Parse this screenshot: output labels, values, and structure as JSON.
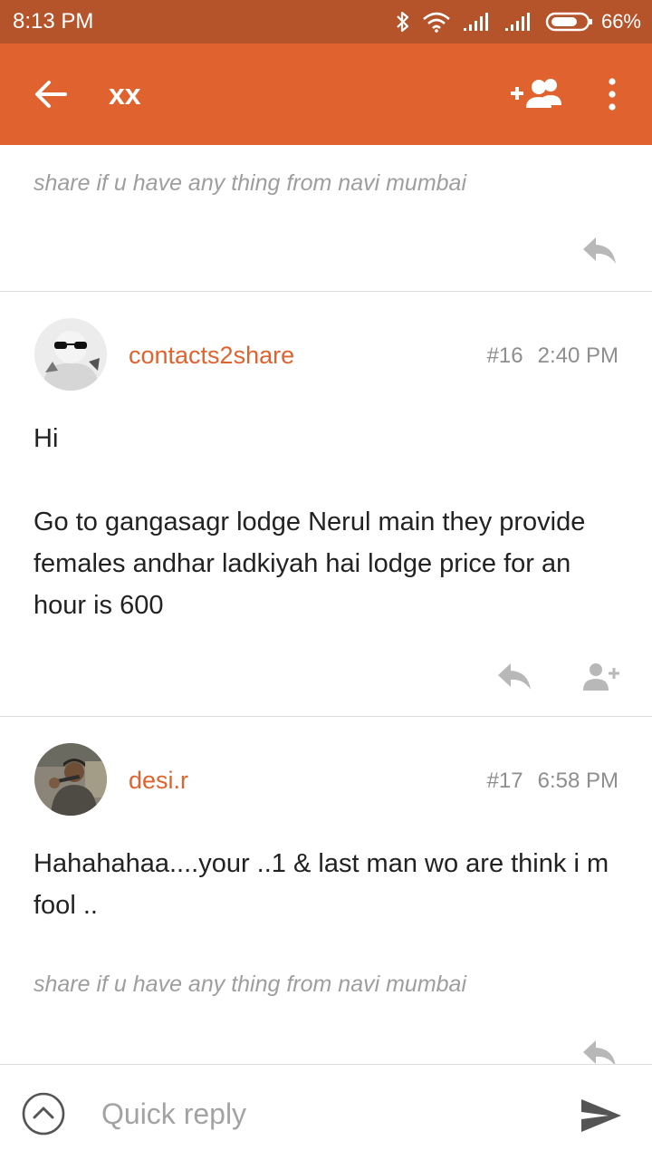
{
  "status_bar": {
    "time": "8:13 PM",
    "battery": "66%",
    "icons": [
      "bluetooth-icon",
      "wifi-icon",
      "signal-icon",
      "signal-icon",
      "battery-icon"
    ]
  },
  "app_bar": {
    "title": "xx",
    "icons": [
      "back-arrow-icon",
      "add-people-icon",
      "more-vert-icon"
    ]
  },
  "thread": {
    "quote_top": "share if u have any thing from navi mumbai",
    "posts": [
      {
        "author": "contacts2share",
        "number": "#16",
        "time": "2:40 PM",
        "body": [
          "Hi",
          "Go to gangasagr lodge Nerul main they provide females andhar ladkiyah hai lodge price for an hour is 600"
        ]
      },
      {
        "author": "desi.r",
        "number": "#17",
        "time": "6:58 PM",
        "body": [
          "Hahahahaa....your ..1 & last man wo are think i m fool .."
        ],
        "quote": "share if u have any thing from navi mumbai"
      }
    ]
  },
  "quick_reply": {
    "placeholder": "Quick reply",
    "value": ""
  },
  "colors": {
    "status_bar": "#b5532a",
    "app_bar": "#e0632f",
    "accent": "#e0632f",
    "muted": "#9e9e9e"
  }
}
